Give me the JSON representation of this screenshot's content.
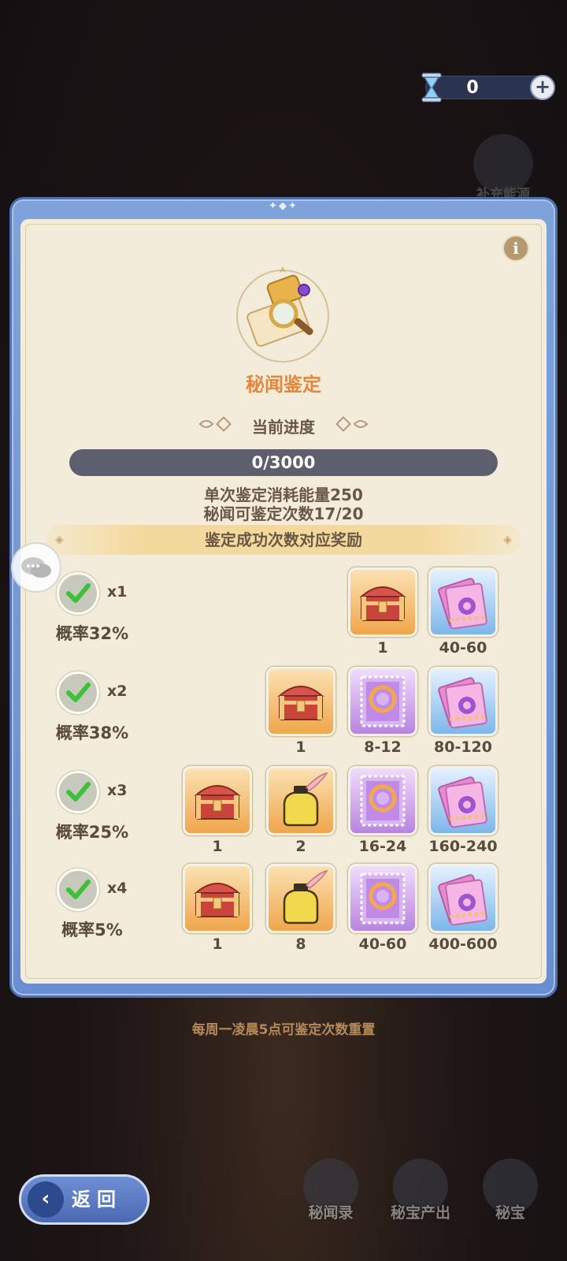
{
  "currency": {
    "value": "0",
    "icon": "hourglass-icon",
    "add_icon": "plus-icon"
  },
  "side": {
    "recharge_label": "补充能源"
  },
  "panel": {
    "title": "秘闻鉴定",
    "progress_label": "当前进度",
    "progress": {
      "current": 0,
      "total": 3000,
      "text": "0/3000"
    },
    "cost_line_1": "单次鉴定消耗能量250",
    "cost_line_2": "秘闻可鉴定次数17/20",
    "reward_header": "鉴定成功次数对应奖励",
    "rows": [
      {
        "mult": "x1",
        "prob": "概率32%",
        "items": [
          {
            "icon": "treasure-chest-icon",
            "bg": "orange",
            "count": "1"
          },
          {
            "icon": "pink-ticket-icon",
            "bg": "blue",
            "count": "40-60"
          }
        ]
      },
      {
        "mult": "x2",
        "prob": "概率38%",
        "items": [
          {
            "icon": "treasure-chest-icon",
            "bg": "orange",
            "count": "1"
          },
          {
            "icon": "purple-stamp-icon",
            "bg": "purple",
            "count": "8-12"
          },
          {
            "icon": "pink-ticket-icon",
            "bg": "blue",
            "count": "80-120"
          }
        ]
      },
      {
        "mult": "x3",
        "prob": "概率25%",
        "items": [
          {
            "icon": "treasure-chest-icon",
            "bg": "orange",
            "count": "1"
          },
          {
            "icon": "ink-bottle-icon",
            "bg": "orange",
            "count": "2"
          },
          {
            "icon": "purple-stamp-icon",
            "bg": "purple",
            "count": "16-24"
          },
          {
            "icon": "pink-ticket-icon",
            "bg": "blue",
            "count": "160-240"
          }
        ]
      },
      {
        "mult": "x4",
        "prob": "概率5%",
        "items": [
          {
            "icon": "treasure-chest-icon",
            "bg": "orange",
            "count": "1"
          },
          {
            "icon": "ink-bottle-icon",
            "bg": "orange",
            "count": "8"
          },
          {
            "icon": "purple-stamp-icon",
            "bg": "purple",
            "count": "40-60"
          },
          {
            "icon": "pink-ticket-icon",
            "bg": "blue",
            "count": "400-600"
          }
        ]
      }
    ]
  },
  "reset_note": "每周一凌晨5点可鉴定次数重置",
  "nav": {
    "back_label": "返回",
    "items": [
      "秘闻录",
      "秘宝产出",
      "秘宝"
    ]
  },
  "colors": {
    "accent_title": "#e3873b",
    "panel_frame": "#6b8ed0",
    "panel_bg": "#f3ecda",
    "check": "#3fbf3a"
  }
}
